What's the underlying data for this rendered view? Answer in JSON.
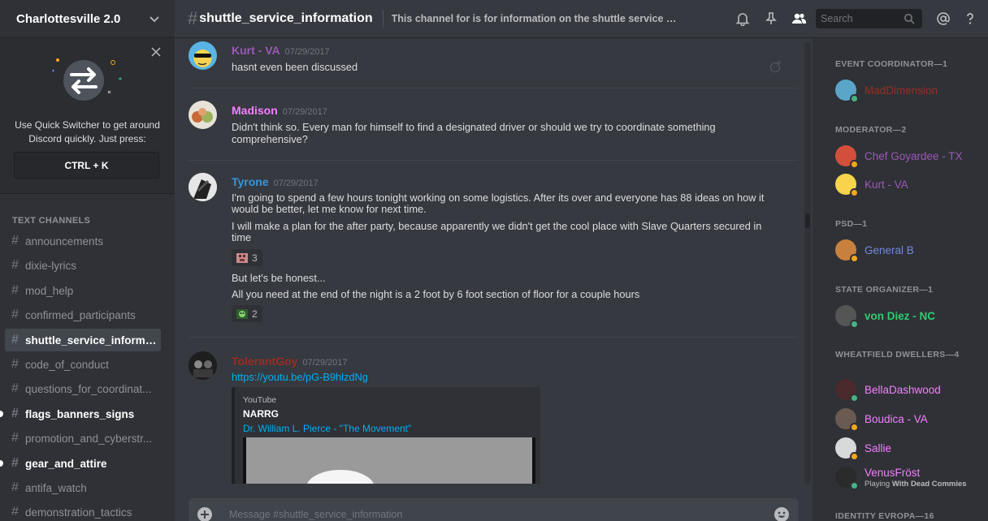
{
  "server": {
    "name": "Charlottesville 2.0"
  },
  "quick_switcher": {
    "text": "Use Quick Switcher to get around Discord quickly. Just press:",
    "shortcut": "CTRL + K"
  },
  "sidebar": {
    "category": "TEXT CHANNELS",
    "channels": [
      {
        "label": "announcements",
        "state": "normal"
      },
      {
        "label": "dixie-lyrics",
        "state": "normal"
      },
      {
        "label": "mod_help",
        "state": "normal"
      },
      {
        "label": "confirmed_participants",
        "state": "normal"
      },
      {
        "label": "shuttle_service_informat...",
        "state": "active"
      },
      {
        "label": "code_of_conduct",
        "state": "normal"
      },
      {
        "label": "questions_for_coordinat...",
        "state": "normal"
      },
      {
        "label": "flags_banners_signs",
        "state": "unread"
      },
      {
        "label": "promotion_and_cyberstr...",
        "state": "normal"
      },
      {
        "label": "gear_and_attire",
        "state": "unread"
      },
      {
        "label": "antifa_watch",
        "state": "normal"
      },
      {
        "label": "demonstration_tactics",
        "state": "normal"
      }
    ]
  },
  "header": {
    "hash": "#",
    "channel_name": "shuttle_service_information",
    "topic": "This channel for is for information on the shuttle service as it bec...",
    "search_placeholder": "Search"
  },
  "messages": [
    {
      "author": "Kurt - VA",
      "author_color": "#9b59b6",
      "timestamp": "07/29/2017",
      "lines": [
        "hasnt even been discussed"
      ]
    },
    {
      "author": "Madison",
      "author_color": "#f47fff",
      "timestamp": "07/29/2017",
      "lines": [
        "Didn't think so. Every man for himself to find a designated driver or should we try to coordinate something",
        "comprehensive?"
      ]
    },
    {
      "author": "Tyrone",
      "author_color": "#3498db",
      "timestamp": "07/29/2017",
      "lines": [
        "I'm going to spend a few hours tonight working on some logistics. After its over and everyone has 88 ideas on how it",
        "would be better, let me know for next time.",
        "I will make a plan for the after party, because apparently we didn't get the cool place with Slave Quarters secured in",
        "time",
        "But let's be honest...",
        "All you need at the end of the night is a 2 foot by 6 foot section of floor for a couple hours"
      ],
      "reactions": [
        {
          "count": "3"
        },
        {
          "count": "2"
        }
      ]
    },
    {
      "author": "TolerantGoy",
      "author_color": "#992d22",
      "timestamp": "07/29/2017",
      "link": "https://youtu.be/pG-B9hlzdNg",
      "embed": {
        "provider": "YouTube",
        "author": "NARRG",
        "title": "Dr. William L. Pierce - \"The Movement\""
      }
    }
  ],
  "composer": {
    "placeholder": "Message #shuttle_service_information"
  },
  "members": {
    "categories": [
      {
        "label": "EVENT COORDINATOR—1"
      },
      {
        "label": "MODERATOR—2"
      },
      {
        "label": "PSD—1"
      },
      {
        "label": "STATE ORGANIZER—1"
      },
      {
        "label": "WHEATFIELD DWELLERS—4"
      },
      {
        "label": "IDENTITY EVROPA—16"
      }
    ],
    "list": [
      {
        "name": "MadDimension",
        "color": "#992d22",
        "status": "#43b581"
      },
      {
        "name": "Chef Goyardee - TX",
        "color": "#9b59b6",
        "status": "#faa61a"
      },
      {
        "name": "Kurt - VA",
        "color": "#9b59b6",
        "status": "#faa61a"
      },
      {
        "name": "General B",
        "color": "#7289da",
        "status": "#faa61a"
      },
      {
        "name": "von Diez - NC",
        "color": "#2ecc71",
        "status": "#43b581"
      },
      {
        "name": "BellaDashwood",
        "color": "#f47fff",
        "status": "#43b581"
      },
      {
        "name": "Boudica - VA",
        "color": "#f47fff",
        "status": "#faa61a"
      },
      {
        "name": "Sallie",
        "color": "#f47fff",
        "status": "#faa61a"
      },
      {
        "name": "VenusFröst",
        "color": "#f47fff",
        "status": "#43b581",
        "activity_prefix": "Playing",
        "activity": "With Dead Commies"
      }
    ]
  }
}
